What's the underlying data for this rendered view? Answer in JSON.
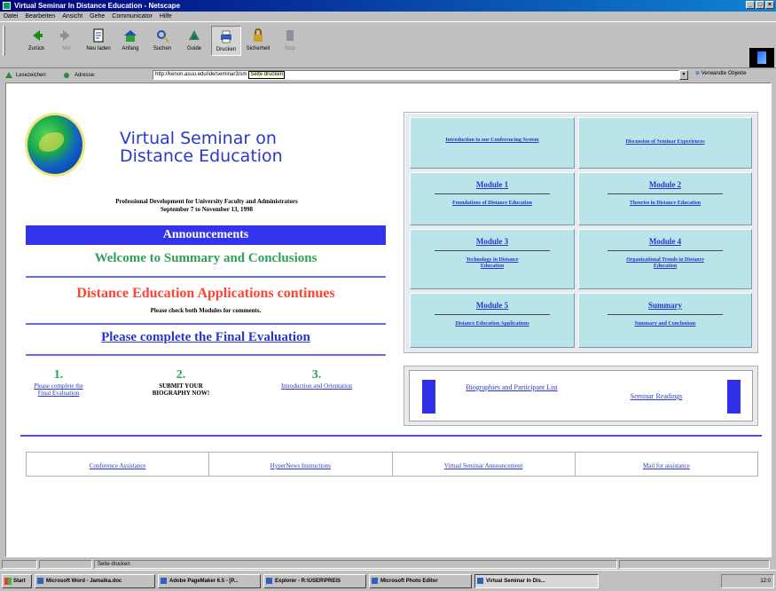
{
  "window": {
    "title": "Virtual Seminar In Distance Education - Netscape"
  },
  "menu": [
    "Datei",
    "Bearbeiten",
    "Ansicht",
    "Gehe",
    "Communicator",
    "Hilfe"
  ],
  "toolbar": {
    "buttons": [
      {
        "label": "Zurück",
        "icon": "back-arrow-icon",
        "enabled": true
      },
      {
        "label": "Vor",
        "icon": "forward-arrow-icon",
        "enabled": false
      },
      {
        "label": "Neu laden",
        "icon": "reload-icon",
        "enabled": true
      },
      {
        "label": "Anfang",
        "icon": "home-icon",
        "enabled": true
      },
      {
        "label": "Suchen",
        "icon": "search-icon",
        "enabled": true
      },
      {
        "label": "Guide",
        "icon": "guide-icon",
        "enabled": true
      },
      {
        "label": "Drucken",
        "icon": "print-icon",
        "enabled": true,
        "pressed": true
      },
      {
        "label": "Sicherheit",
        "icon": "security-lock-icon",
        "enabled": true
      },
      {
        "label": "Stop",
        "icon": "stop-icon",
        "enabled": false
      }
    ]
  },
  "location": {
    "bookmarks_label": "Lesezeichen",
    "address_label": "Adresse:",
    "url": "http://kenon.asuu.edu/ide/seminar3/sm",
    "tooltip": "Seite drucken",
    "related_label": "Verwandte Objekte"
  },
  "page": {
    "site_title_line1": "Virtual Seminar on",
    "site_title_line2": "Distance Education",
    "subtitle_line1": "Professional Development for University Faculty and Administrators",
    "subtitle_line2": "September 7 to November 13, 1998",
    "announcements_heading": "Announcements",
    "welcome": "Welcome to Summary and Conclusions",
    "dea_heading": "Distance Education Applications continues",
    "dea_sub": "Please check both Modules for comments.",
    "final_eval": "Please complete the Final Evaluation",
    "steps": [
      {
        "num": "1.",
        "text": "Please complete the Final Evaluation",
        "link": true
      },
      {
        "num": "2.",
        "text": "SUBMIT YOUR BIOGRAPHY NOW!",
        "link": false
      },
      {
        "num": "3.",
        "text": "Introduction and Orientation",
        "link": true
      }
    ]
  },
  "modules": {
    "intro": "Introduction to our Conferencing System",
    "discussion": "Discussion of Seminar Experiences",
    "m1_title": "Module 1",
    "m1_link": "Foundations of Distance Education",
    "m2_title": "Module 2",
    "m2_link": "Theories in Distance Education",
    "m3_title": "Module 3",
    "m3_link": "Technology in Distance Education",
    "m4_title": "Module 4",
    "m4_link": "Organizational Trends in Distance Education",
    "m5_title": "Module 5",
    "m5_link": "Distance Education Applications",
    "summary_title": "Summary",
    "summary_link": "Summary and Conclusions"
  },
  "bios": {
    "bio_link": "Biographies and Participant List",
    "readings_link": "Seminar Readings"
  },
  "footer": [
    "Conference Assistance",
    "HyperNews Instructions",
    "Virtual Seminar Announcement",
    "Mail for assistance"
  ],
  "status": {
    "text": "Seite drucken"
  },
  "taskbar": {
    "start": "Start",
    "tasks": [
      "Microsoft Word - Jamaika.doc",
      "Adobe PageMaker 6.5 - [P...",
      "Explorer - R:\\USER\\PREIS",
      "Microsoft Photo Editor",
      "Virtual Seminar In Dis..."
    ],
    "clock": "12:0"
  },
  "colors": {
    "link": "#2a38c8",
    "accent_green": "#2fa05a",
    "accent_red": "#ff4433",
    "announce_bar": "#3333ee",
    "module_cell": "#b8e4ea"
  }
}
